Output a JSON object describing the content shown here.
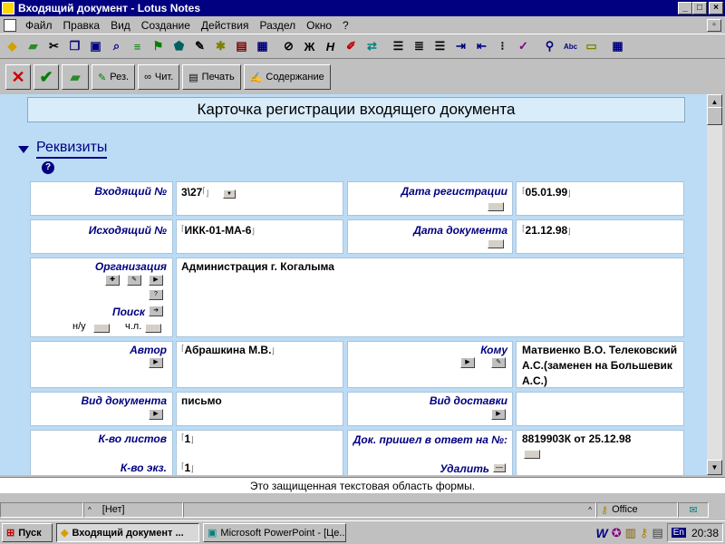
{
  "window": {
    "title": "Входящий документ - Lotus Notes"
  },
  "menu": [
    "Файл",
    "Правка",
    "Вид",
    "Создание",
    "Действия",
    "Раздел",
    "Окно",
    "?"
  ],
  "toolbar_icons": [
    "open-icon",
    "database-icon",
    "cut-icon",
    "copy-icon",
    "paste-icon",
    "find-icon",
    "ruler-icon",
    "bookmark-icon",
    "navigator-icon",
    "edit-icon",
    "sparkle-icon",
    "print-icon",
    "table-icon",
    "attach-icon",
    "bold-icon",
    "italic-icon",
    "highlight-icon",
    "refresh-icon",
    "align-left-icon",
    "align-center-icon",
    "align-right-icon",
    "indent-icon",
    "outdent-icon",
    "bullets-icon",
    "spell-icon",
    "search-icon",
    "text-icon",
    "field-icon",
    "grid-icon"
  ],
  "action_bar": {
    "res_label": "Рез.",
    "read_label": "Чит.",
    "print_label": "Печать",
    "contents_label": "Содержание"
  },
  "form": {
    "title": "Карточка регистрации входящего документа",
    "section": "Реквизиты",
    "incoming_no_label": "Входящий №",
    "incoming_no": "3\\27",
    "reg_date_label": "Дата регистрации",
    "reg_date": "05.01.99",
    "outgoing_no_label": "Исходящий №",
    "outgoing_no": "ИКК-01-МА-6",
    "doc_date_label": "Дата документа",
    "doc_date": "21.12.98",
    "org_label": "Организация",
    "org": "Администрация г. Когалыма",
    "search_label": "Поиск",
    "nu_label": "н/у",
    "chl_label": "ч.л.",
    "author_label": "Автор",
    "author": "Абрашкина М.В.",
    "to_label": "Кому",
    "to": "Матвиенко В.О. Телековский А.С.(заменен на Большевик А.С.)",
    "doc_type_label": "Вид документа",
    "doc_type": "письмо",
    "delivery_label": "Вид доставки",
    "sheets_label": "К-во листов",
    "sheets": "1",
    "copies_label": "К-во экз.",
    "copies": "1",
    "reply_label": "Док. пришел в ответ на №:",
    "reply": "8819903К от  25.12.98",
    "delete_label": "Удалить"
  },
  "protected_text": "Это защищенная текстовая область формы.",
  "status": {
    "field2": "[Нет]",
    "location": "Office"
  },
  "taskbar": {
    "start": "Пуск",
    "task1": "Входящий документ ...",
    "task2": "Microsoft PowerPoint - [Це...",
    "lang": "En",
    "clock": "20:38"
  }
}
